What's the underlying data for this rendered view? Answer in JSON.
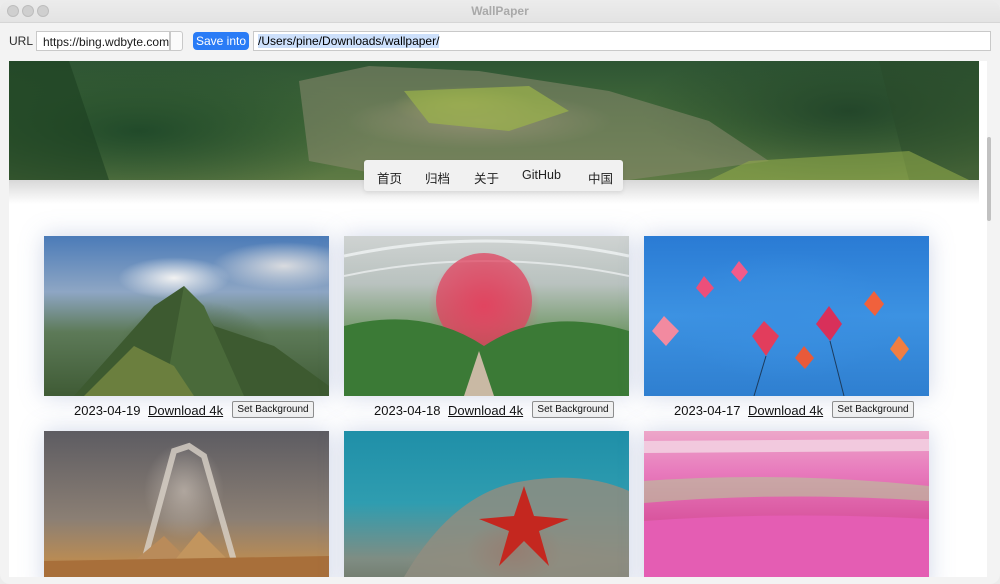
{
  "window": {
    "title": "WallPaper"
  },
  "toolbar": {
    "url_label": "URL",
    "url_value": "https://bing.wdbyte.com",
    "save_label": "Save into",
    "path_value": "/Users/pine/Downloads/wallpaper/"
  },
  "nav": {
    "items": [
      "首页",
      "归档",
      "关于",
      "GitHub",
      "中国"
    ]
  },
  "cards": [
    {
      "date": "2023-04-19",
      "download": "Download 4k",
      "set_bg": "Set Background"
    },
    {
      "date": "2023-04-18",
      "download": "Download 4k",
      "set_bg": "Set Background"
    },
    {
      "date": "2023-04-17",
      "download": "Download 4k",
      "set_bg": "Set Background"
    }
  ],
  "icons": {
    "window_controls": [
      "close-icon",
      "minimize-icon",
      "zoom-icon"
    ]
  }
}
